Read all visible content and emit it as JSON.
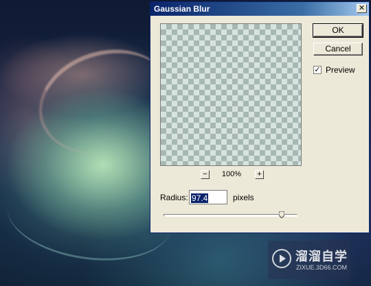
{
  "dialog": {
    "title": "Gaussian Blur",
    "close_glyph": "✕",
    "ok_label": "OK",
    "cancel_label": "Cancel",
    "preview": {
      "label": "Preview",
      "checked": true,
      "check_glyph": "✓"
    },
    "zoom": {
      "minus": "−",
      "plus": "+",
      "level": "100%"
    },
    "radius": {
      "label": "Radius:",
      "value": "97.4",
      "units": "pixels",
      "slider_fraction": 0.88
    }
  },
  "watermark": {
    "name": "溜溜自学",
    "url": "ZIXUE.3D66.COM",
    "icon": "play-icon"
  },
  "colors": {
    "titlebar": "#0a246a",
    "dialog_bg": "#ece9d8",
    "selection": "#0a246a"
  }
}
